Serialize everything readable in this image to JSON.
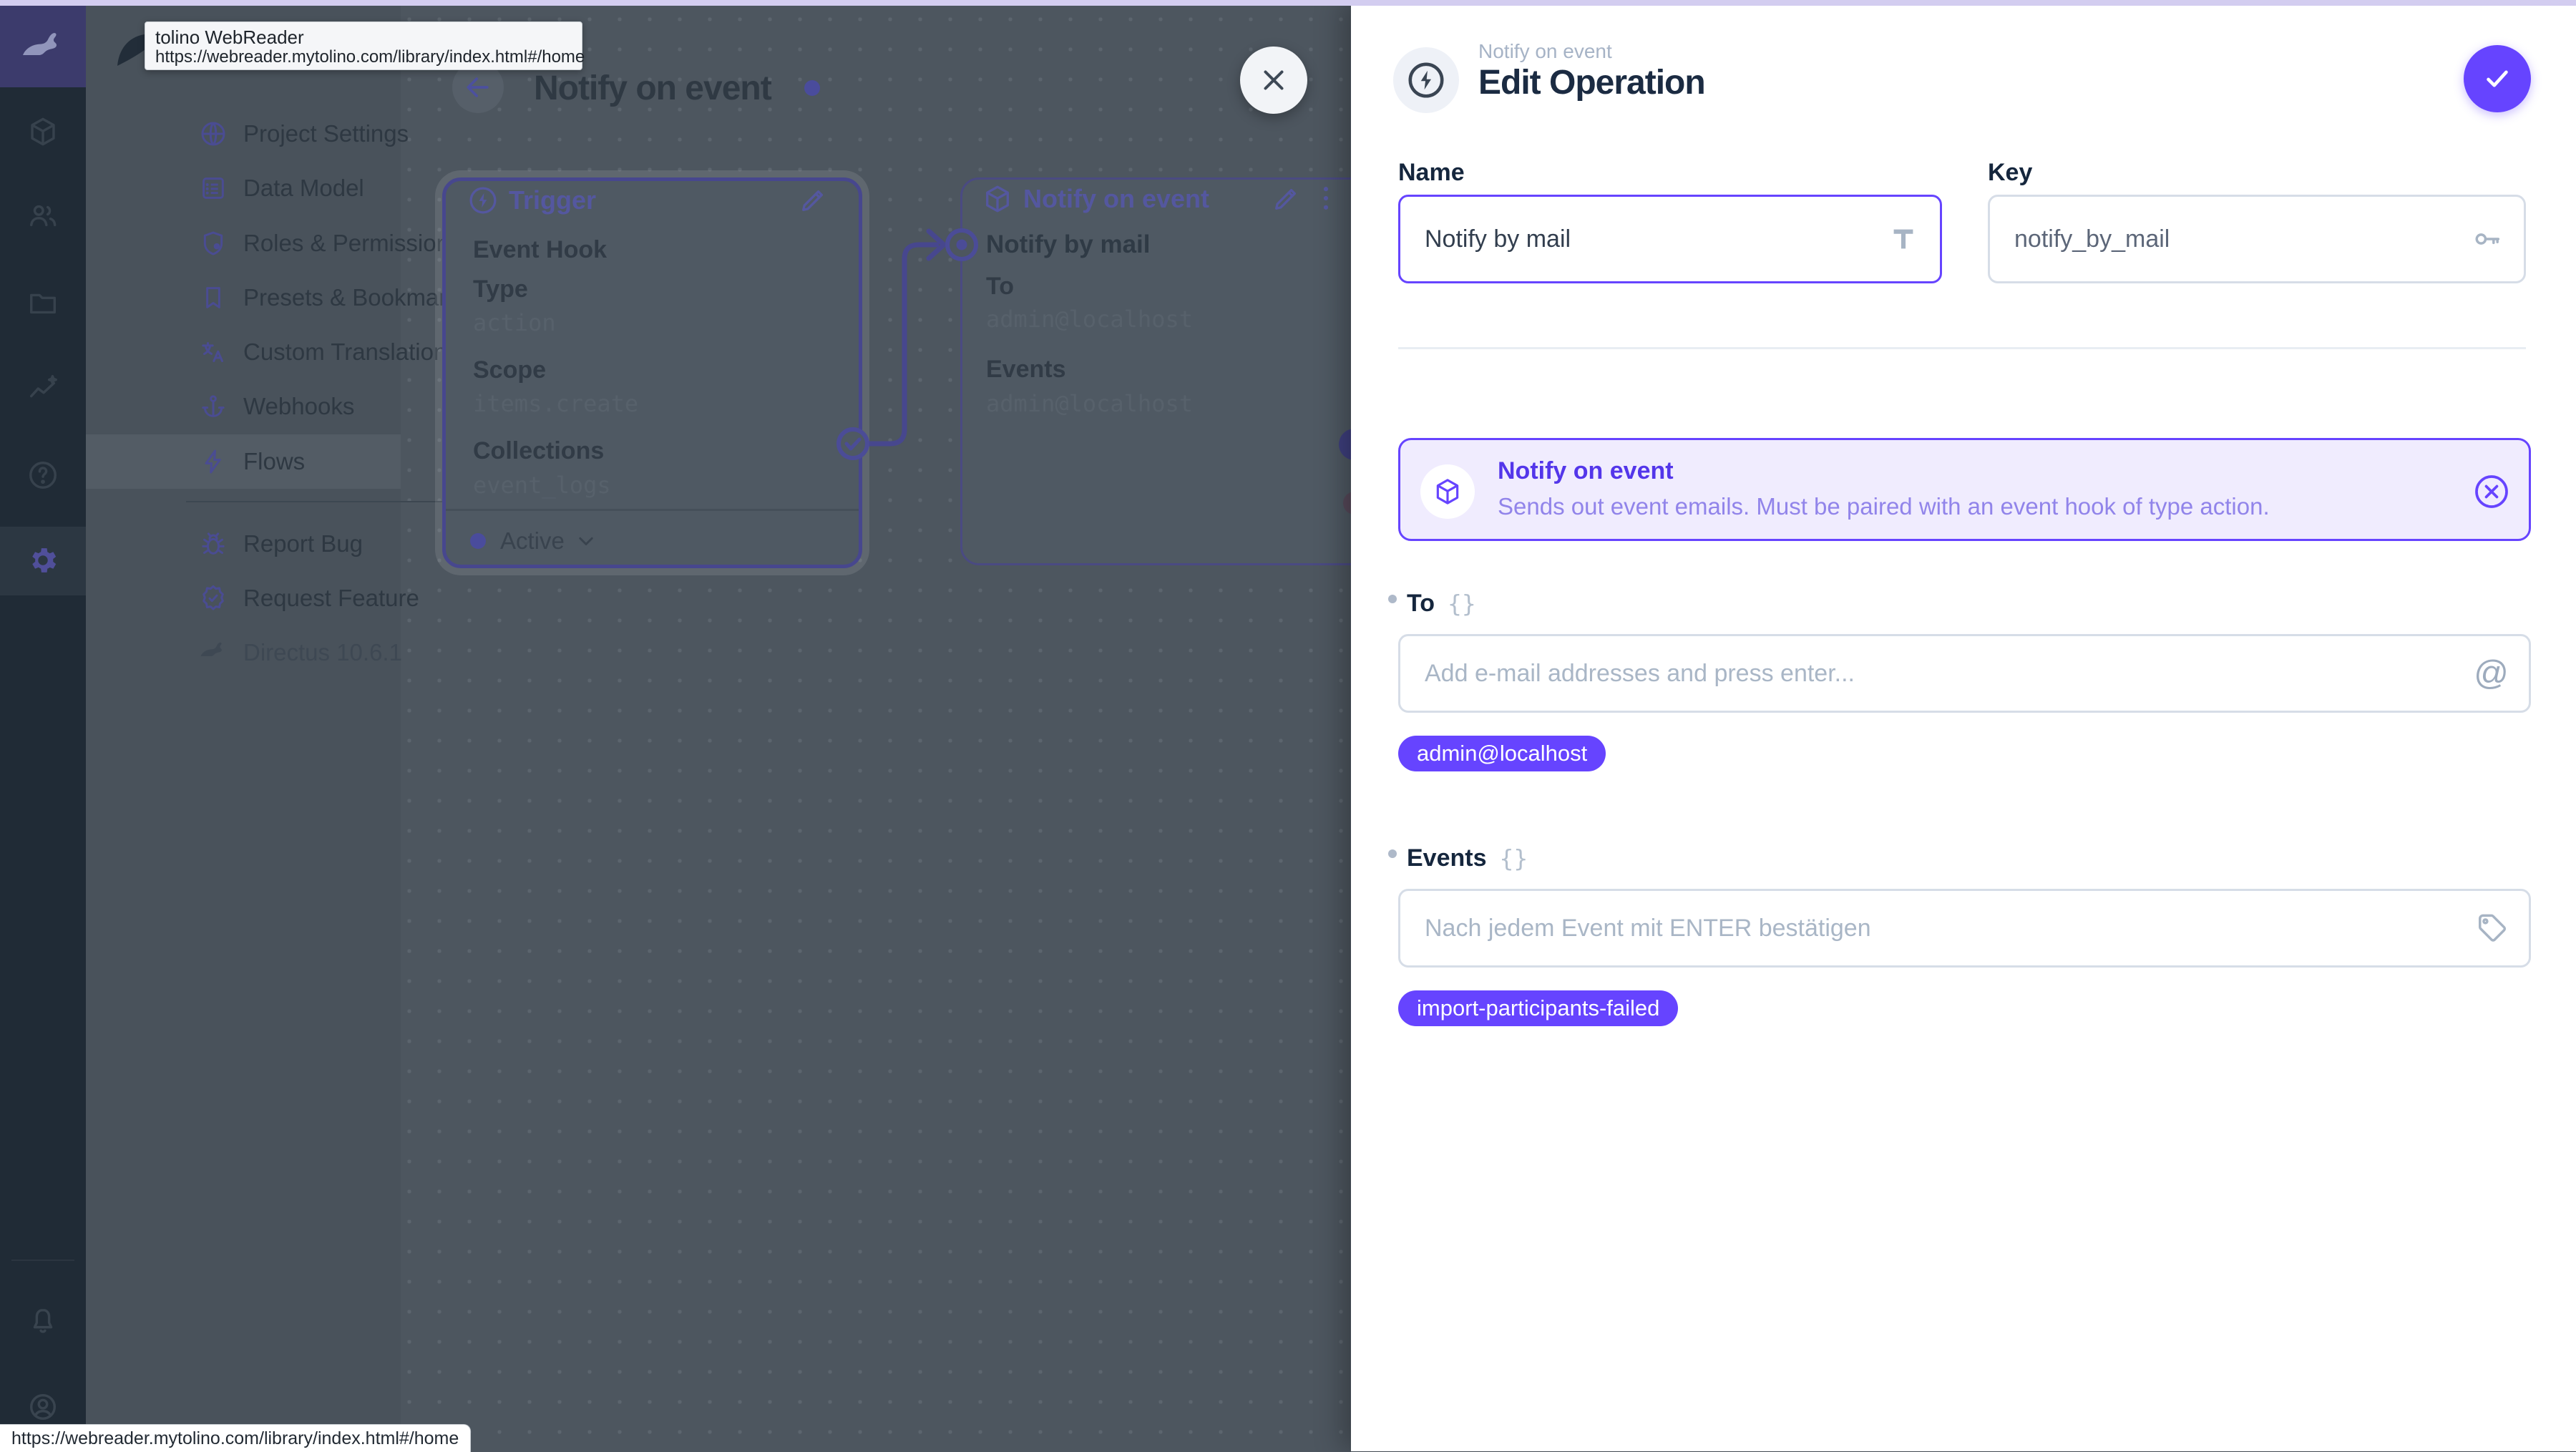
{
  "browser": {
    "tooltip_title": "tolino WebReader",
    "tooltip_url": "https://webreader.mytolino.com/library/index.html#/home",
    "status_url": "https://webreader.mytolino.com/library/index.html#/home"
  },
  "colors": {
    "accent": "#6644ff",
    "chip_bg": "#6644ff",
    "banner_bg": "#f0ecfe",
    "active_dot": "#6644ff"
  },
  "sidebar": {
    "items": [
      {
        "label": "Project Settings",
        "icon": "globe-icon"
      },
      {
        "label": "Data Model",
        "icon": "list-icon"
      },
      {
        "label": "Roles & Permissions",
        "icon": "shield-person-icon"
      },
      {
        "label": "Presets & Bookmar...",
        "icon": "bookmark-icon"
      },
      {
        "label": "Custom Translations",
        "icon": "translate-icon"
      },
      {
        "label": "Webhooks",
        "icon": "anchor-icon"
      },
      {
        "label": "Flows",
        "icon": "bolt-icon",
        "active": true
      },
      {
        "label": "Report Bug",
        "icon": "bug-icon"
      },
      {
        "label": "Request Feature",
        "icon": "feature-badge-icon"
      },
      {
        "label": "Directus 10.6.1",
        "icon": "rabbit-icon",
        "muted": true
      }
    ]
  },
  "canvas": {
    "title": "Notify on event",
    "trigger_panel": {
      "title": "Trigger",
      "type_label": "Event Hook",
      "fields": [
        {
          "label": "Type",
          "value": "action"
        },
        {
          "label": "Scope",
          "value": "items.create"
        },
        {
          "label": "Collections",
          "value": "event_logs"
        }
      ],
      "status": "Active"
    },
    "operation_panel": {
      "title": "Notify on event",
      "name": "Notify by mail",
      "fields": [
        {
          "label": "To",
          "value": "admin@localhost"
        },
        {
          "label": "Events",
          "value": "admin@localhost"
        }
      ]
    }
  },
  "drawer": {
    "context": "Notify on event",
    "title": "Edit Operation",
    "name_field": {
      "label": "Name",
      "value": "Notify by mail"
    },
    "key_field": {
      "label": "Key",
      "value": "notify_by_mail"
    },
    "banner": {
      "title": "Notify on event",
      "description": "Sends out event emails. Must be paired with an event hook of type action."
    },
    "to_field": {
      "label": "To",
      "placeholder": "Add e-mail addresses and press enter...",
      "chip": "admin@localhost"
    },
    "events_field": {
      "label": "Events",
      "placeholder": "Nach jedem Event mit ENTER bestätigen",
      "chip": "import-participants-failed"
    }
  }
}
